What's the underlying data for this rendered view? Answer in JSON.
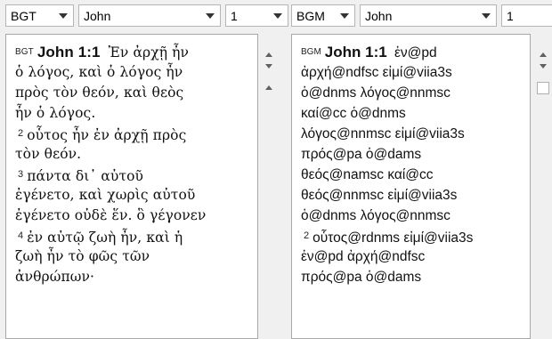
{
  "toolbar": {
    "left": {
      "version": "BGT",
      "book": "John",
      "chapter": "1"
    },
    "right": {
      "version": "BGM",
      "book": "John",
      "chapter": "1"
    }
  },
  "left_pane": {
    "version_tag": "BGT",
    "reference": "John 1:1",
    "lines": [
      {
        "verse": "",
        "text": "Ἐν ἀρχῇ ἦν"
      },
      {
        "verse": "",
        "text": "ὁ λόγος, καὶ ὁ λόγος ἦν"
      },
      {
        "verse": "",
        "text": "πρὸς τὸν θεόν, καὶ θεὸς"
      },
      {
        "verse": "",
        "text": "ἦν ὁ λόγος."
      },
      {
        "verse": "2",
        "text": "οὗτος ἦν ἐν ἀρχῇ πρὸς"
      },
      {
        "verse": "",
        "text": "τὸν θεόν."
      },
      {
        "verse": "3",
        "text": "πάντα δι᾽ αὐτοῦ"
      },
      {
        "verse": "",
        "text": "ἐγένετο, καὶ χωρὶς αὐτοῦ"
      },
      {
        "verse": "",
        "text": "ἐγένετο οὐδὲ ἕν. ὃ γέγονεν"
      },
      {
        "verse": "4",
        "text": "ἐν αὐτῷ ζωὴ ἦν, καὶ ἡ"
      },
      {
        "verse": "",
        "text": "ζωὴ ἦν τὸ φῶς τῶν"
      },
      {
        "verse": "",
        "text": "ἀνθρώπων·"
      }
    ]
  },
  "right_pane": {
    "version_tag": "BGM",
    "reference": "John 1:1",
    "lines": [
      {
        "verse": "",
        "text": "ἐν@pd"
      },
      {
        "verse": "",
        "text": "ἀρχή@ndfsc εἰμί@viia3s"
      },
      {
        "verse": "",
        "text": "ὁ@dnms λόγος@nnmsc"
      },
      {
        "verse": "",
        "text": "καί@cc ὁ@dnms"
      },
      {
        "verse": "",
        "text": "λόγος@nnmsc εἰμί@viia3s"
      },
      {
        "verse": "",
        "text": "πρός@pa ὁ@dams"
      },
      {
        "verse": "",
        "text": "θεός@namsc καί@cc"
      },
      {
        "verse": "",
        "text": "θεός@nnmsc εἰμί@viia3s"
      },
      {
        "verse": "",
        "text": "ὁ@dnms λόγος@nnmsc"
      },
      {
        "verse": "2",
        "text": "οὗτος@rdnms εἰμί@viia3s"
      },
      {
        "verse": "",
        "text": "ἐν@pd ἀρχή@ndfsc"
      },
      {
        "verse": "",
        "text": "πρός@pa ὁ@dams"
      }
    ]
  }
}
